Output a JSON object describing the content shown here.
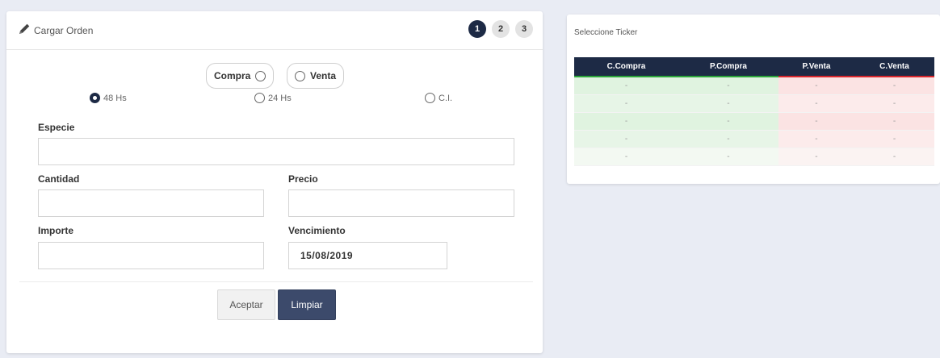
{
  "order_card": {
    "title": "Cargar Orden",
    "steps": [
      "1",
      "2",
      "3"
    ],
    "side": {
      "compra": "Compra",
      "venta": "Venta"
    },
    "terms": [
      "48 Hs",
      "24 Hs",
      "C.I."
    ],
    "fields": {
      "especie_label": "Especie",
      "especie_value": "",
      "cantidad_label": "Cantidad",
      "cantidad_value": "",
      "precio_label": "Precio",
      "precio_value": "",
      "importe_label": "Importe",
      "importe_value": "",
      "vencimiento_label": "Vencimiento",
      "vencimiento_value": "15/08/2019"
    },
    "buttons": {
      "accept": "Aceptar",
      "clear": "Limpiar"
    }
  },
  "ticker_card": {
    "title": "Seleccione Ticker",
    "columns": [
      "C.Compra",
      "P.Compra",
      "P.Venta",
      "C.Venta"
    ],
    "rows": [
      [
        "-",
        "-",
        "-",
        "-"
      ],
      [
        "-",
        "-",
        "-",
        "-"
      ],
      [
        "-",
        "-",
        "-",
        "-"
      ],
      [
        "-",
        "-",
        "-",
        "-"
      ],
      [
        "-",
        "-",
        "-",
        "-"
      ]
    ]
  },
  "colors": {
    "primary": "#1d2a45",
    "buy": "#2ca53a",
    "sell": "#d9262c"
  }
}
